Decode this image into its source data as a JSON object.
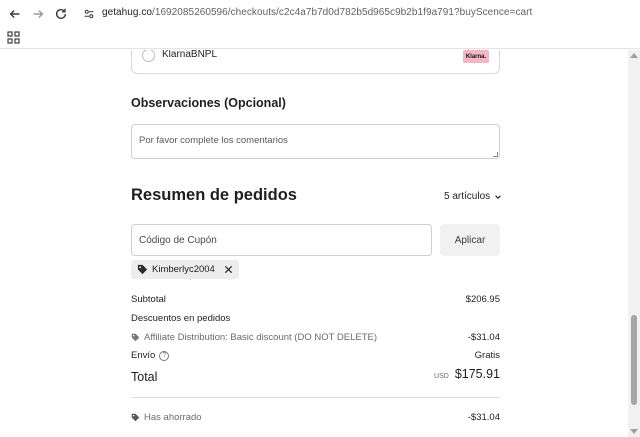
{
  "browser": {
    "url_host": "getahug.co",
    "url_path": "/1692085260596/checkouts/c2c4a7b7d0d782b5d965c9b2b1f9a791?buyScence=cart"
  },
  "payment": {
    "option_label": "KlarnaBNPL",
    "badge_text": "Klarna."
  },
  "notes": {
    "heading": "Observaciones (Opcional)",
    "placeholder": "Por favor complete los comentarios"
  },
  "summary": {
    "heading": "Resumen de pedidos",
    "items_count": "5 artículos",
    "coupon_placeholder": "Código de Cupón",
    "apply_label": "Aplicar",
    "applied_coupon": "Kimberlyc2004",
    "subtotal_label": "Subtotal",
    "subtotal_value": "$206.95",
    "discounts_label": "Descuentos en pedidos",
    "discount_name": "Affiliate Distribution: Basic discount (DO NOT DELETE)",
    "discount_value": "-$31.04",
    "shipping_label": "Envío",
    "shipping_value": "Gratis",
    "total_label": "Total",
    "currency": "USD",
    "total_value": "$175.91",
    "saved_label": "Has ahorrado",
    "saved_value": "-$31.04"
  },
  "colors": {
    "klarna_pink": "#f4b6c7",
    "chip_bg": "#ededed"
  }
}
